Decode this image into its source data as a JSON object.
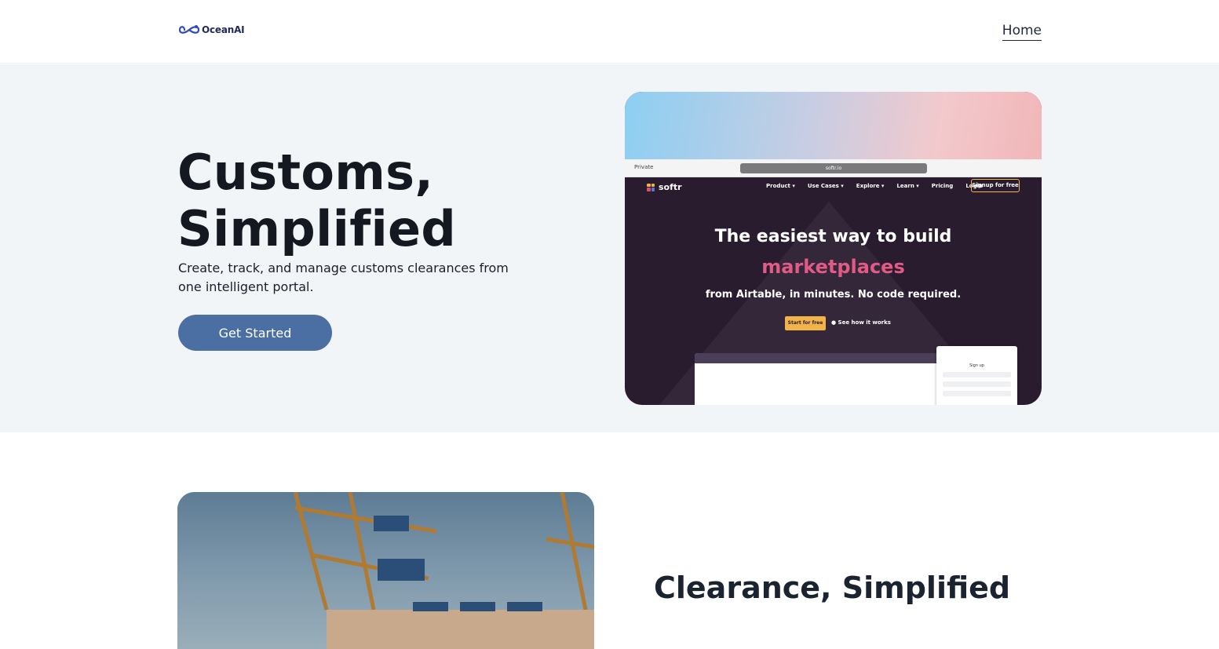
{
  "header": {
    "logo_text": "OceanAI",
    "nav_home": "Home"
  },
  "hero": {
    "title_line1": "Customs,",
    "title_line2": "Simplified",
    "subtitle": "Create, track, and manage customs clearances from one intelligent portal.",
    "cta_label": "Get Started"
  },
  "hero_image": {
    "browser_private": "Private",
    "url": "softr.io",
    "brand": "softr",
    "nav": [
      "Product ▾",
      "Use Cases ▾",
      "Explore ▾",
      "Learn ▾",
      "Pricing",
      "Login"
    ],
    "signup": "Signup for free",
    "headline_a": "The easiest way to build",
    "headline_b": "marketplaces",
    "headline_c": "from Airtable, in minutes. No code required.",
    "btn_start": "Start for free",
    "btn_how": "See how it works",
    "panel_title": "Sign up"
  },
  "section2": {
    "title": "Clearance, Simplified"
  },
  "colors": {
    "accent": "#4b6fa3",
    "hero_bg": "#f1f5f8"
  }
}
